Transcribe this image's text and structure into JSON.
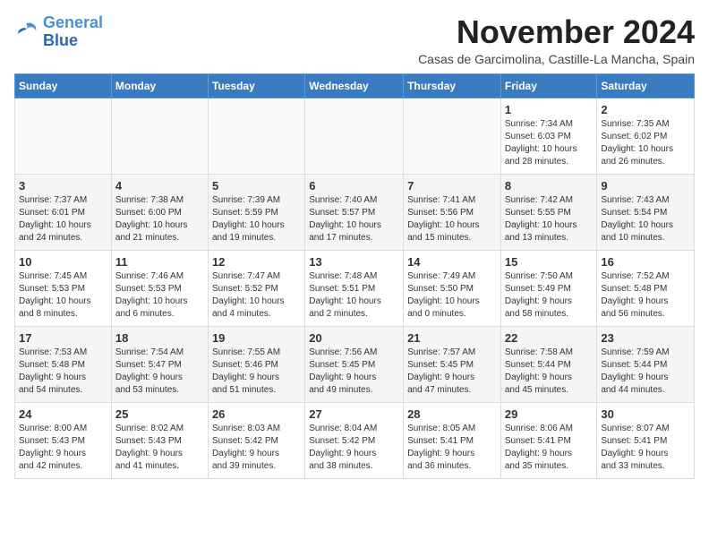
{
  "logo": {
    "line1": "General",
    "line2": "Blue"
  },
  "title": "November 2024",
  "location": "Casas de Garcimolina, Castille-La Mancha, Spain",
  "headers": [
    "Sunday",
    "Monday",
    "Tuesday",
    "Wednesday",
    "Thursday",
    "Friday",
    "Saturday"
  ],
  "weeks": [
    [
      {
        "day": "",
        "content": ""
      },
      {
        "day": "",
        "content": ""
      },
      {
        "day": "",
        "content": ""
      },
      {
        "day": "",
        "content": ""
      },
      {
        "day": "",
        "content": ""
      },
      {
        "day": "1",
        "content": "Sunrise: 7:34 AM\nSunset: 6:03 PM\nDaylight: 10 hours\nand 28 minutes."
      },
      {
        "day": "2",
        "content": "Sunrise: 7:35 AM\nSunset: 6:02 PM\nDaylight: 10 hours\nand 26 minutes."
      }
    ],
    [
      {
        "day": "3",
        "content": "Sunrise: 7:37 AM\nSunset: 6:01 PM\nDaylight: 10 hours\nand 24 minutes."
      },
      {
        "day": "4",
        "content": "Sunrise: 7:38 AM\nSunset: 6:00 PM\nDaylight: 10 hours\nand 21 minutes."
      },
      {
        "day": "5",
        "content": "Sunrise: 7:39 AM\nSunset: 5:59 PM\nDaylight: 10 hours\nand 19 minutes."
      },
      {
        "day": "6",
        "content": "Sunrise: 7:40 AM\nSunset: 5:57 PM\nDaylight: 10 hours\nand 17 minutes."
      },
      {
        "day": "7",
        "content": "Sunrise: 7:41 AM\nSunset: 5:56 PM\nDaylight: 10 hours\nand 15 minutes."
      },
      {
        "day": "8",
        "content": "Sunrise: 7:42 AM\nSunset: 5:55 PM\nDaylight: 10 hours\nand 13 minutes."
      },
      {
        "day": "9",
        "content": "Sunrise: 7:43 AM\nSunset: 5:54 PM\nDaylight: 10 hours\nand 10 minutes."
      }
    ],
    [
      {
        "day": "10",
        "content": "Sunrise: 7:45 AM\nSunset: 5:53 PM\nDaylight: 10 hours\nand 8 minutes."
      },
      {
        "day": "11",
        "content": "Sunrise: 7:46 AM\nSunset: 5:53 PM\nDaylight: 10 hours\nand 6 minutes."
      },
      {
        "day": "12",
        "content": "Sunrise: 7:47 AM\nSunset: 5:52 PM\nDaylight: 10 hours\nand 4 minutes."
      },
      {
        "day": "13",
        "content": "Sunrise: 7:48 AM\nSunset: 5:51 PM\nDaylight: 10 hours\nand 2 minutes."
      },
      {
        "day": "14",
        "content": "Sunrise: 7:49 AM\nSunset: 5:50 PM\nDaylight: 10 hours\nand 0 minutes."
      },
      {
        "day": "15",
        "content": "Sunrise: 7:50 AM\nSunset: 5:49 PM\nDaylight: 9 hours\nand 58 minutes."
      },
      {
        "day": "16",
        "content": "Sunrise: 7:52 AM\nSunset: 5:48 PM\nDaylight: 9 hours\nand 56 minutes."
      }
    ],
    [
      {
        "day": "17",
        "content": "Sunrise: 7:53 AM\nSunset: 5:48 PM\nDaylight: 9 hours\nand 54 minutes."
      },
      {
        "day": "18",
        "content": "Sunrise: 7:54 AM\nSunset: 5:47 PM\nDaylight: 9 hours\nand 53 minutes."
      },
      {
        "day": "19",
        "content": "Sunrise: 7:55 AM\nSunset: 5:46 PM\nDaylight: 9 hours\nand 51 minutes."
      },
      {
        "day": "20",
        "content": "Sunrise: 7:56 AM\nSunset: 5:45 PM\nDaylight: 9 hours\nand 49 minutes."
      },
      {
        "day": "21",
        "content": "Sunrise: 7:57 AM\nSunset: 5:45 PM\nDaylight: 9 hours\nand 47 minutes."
      },
      {
        "day": "22",
        "content": "Sunrise: 7:58 AM\nSunset: 5:44 PM\nDaylight: 9 hours\nand 45 minutes."
      },
      {
        "day": "23",
        "content": "Sunrise: 7:59 AM\nSunset: 5:44 PM\nDaylight: 9 hours\nand 44 minutes."
      }
    ],
    [
      {
        "day": "24",
        "content": "Sunrise: 8:00 AM\nSunset: 5:43 PM\nDaylight: 9 hours\nand 42 minutes."
      },
      {
        "day": "25",
        "content": "Sunrise: 8:02 AM\nSunset: 5:43 PM\nDaylight: 9 hours\nand 41 minutes."
      },
      {
        "day": "26",
        "content": "Sunrise: 8:03 AM\nSunset: 5:42 PM\nDaylight: 9 hours\nand 39 minutes."
      },
      {
        "day": "27",
        "content": "Sunrise: 8:04 AM\nSunset: 5:42 PM\nDaylight: 9 hours\nand 38 minutes."
      },
      {
        "day": "28",
        "content": "Sunrise: 8:05 AM\nSunset: 5:41 PM\nDaylight: 9 hours\nand 36 minutes."
      },
      {
        "day": "29",
        "content": "Sunrise: 8:06 AM\nSunset: 5:41 PM\nDaylight: 9 hours\nand 35 minutes."
      },
      {
        "day": "30",
        "content": "Sunrise: 8:07 AM\nSunset: 5:41 PM\nDaylight: 9 hours\nand 33 minutes."
      }
    ]
  ]
}
